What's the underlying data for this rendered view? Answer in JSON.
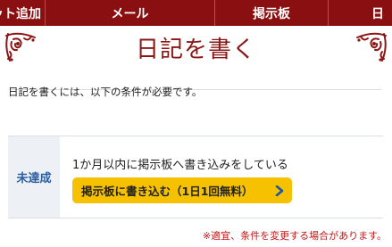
{
  "nav": {
    "items": [
      {
        "label": "ット追加"
      },
      {
        "label": "メール"
      },
      {
        "label": "掲示板"
      },
      {
        "label": "日"
      }
    ]
  },
  "page": {
    "title": "日記を書く",
    "intro": "日記を書くには、以下の条件が必要です。"
  },
  "condition": {
    "status": "未達成",
    "text": "1か月以内に掲示板へ書き込みをしている",
    "button_label": "掲示板に書き込む（1日1回無料）"
  },
  "note": "※適宜、条件を変更する場合があります。",
  "colors": {
    "nav_bg": "#8a0f10",
    "title": "#8a1616",
    "status_text": "#2a5ea0",
    "button_bg": "#f6c100",
    "note": "#c01818"
  },
  "icons": {
    "ornament": "floral-corner-ornament-icon",
    "button_arrow": "chevron-right-icon"
  }
}
